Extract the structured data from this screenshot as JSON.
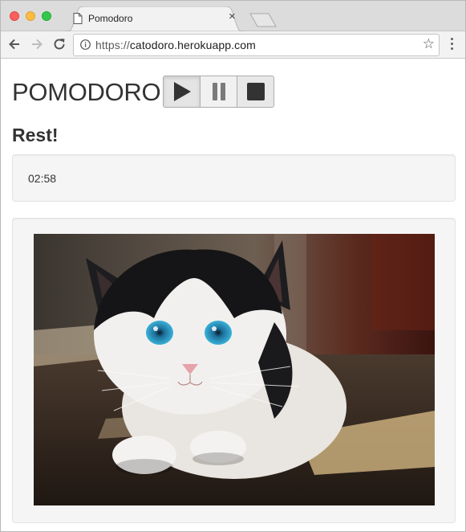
{
  "browser": {
    "tab": {
      "title": "Pomodoro"
    },
    "address": {
      "scheme": "https://",
      "host": "catodoro.herokuapp.com"
    },
    "icons": [
      "back-arrow-icon",
      "forward-arrow-icon",
      "reload-icon",
      "info-icon",
      "star-icon",
      "menu-icon",
      "close-icon",
      "document-icon"
    ]
  },
  "app": {
    "title": "POMODORO",
    "controls": [
      "play-icon",
      "pause-icon",
      "stop-icon"
    ],
    "status": "Rest!",
    "timer": "02:58"
  },
  "colors": {
    "traffic_red": "#fc605c",
    "traffic_yellow": "#fdbc40",
    "traffic_green": "#34c84a",
    "text": "#333333",
    "well": "#f5f5f5"
  }
}
